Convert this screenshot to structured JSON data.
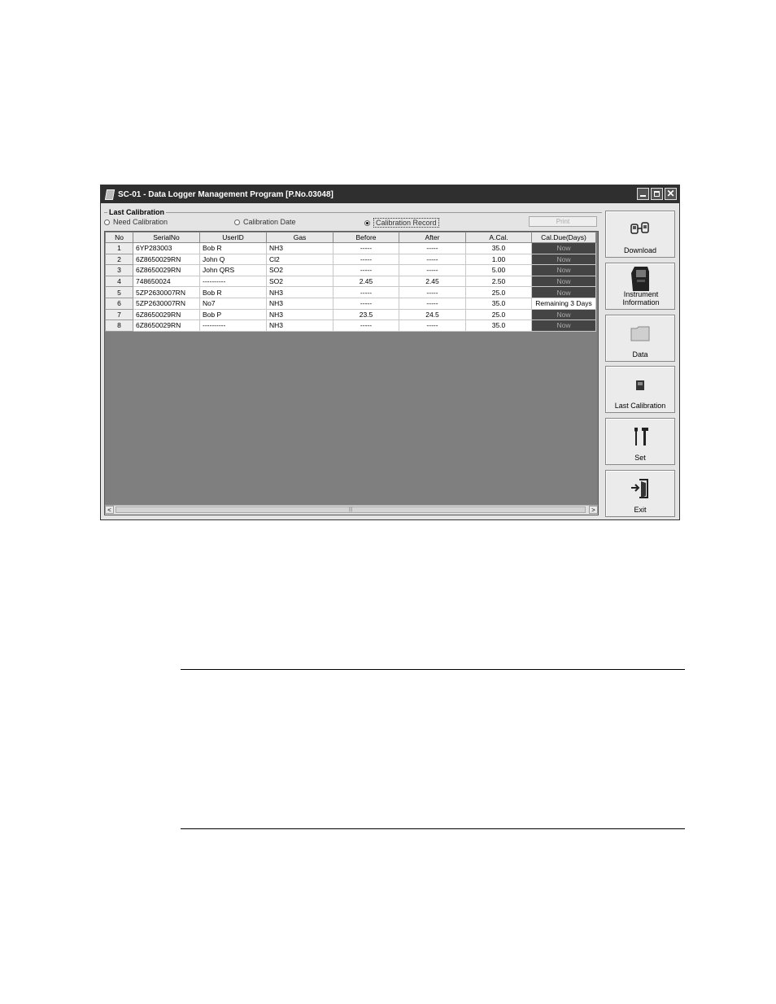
{
  "window": {
    "title": "SC-01 - Data Logger Management Program [P.No.03048]",
    "close_glyph": "✕"
  },
  "filter": {
    "group_label": "Last Calibration",
    "options": [
      "Need Calibration",
      "Calibration Date",
      "Calibration Record"
    ],
    "selected": "Calibration Record",
    "print_label": "Print"
  },
  "table": {
    "columns": [
      "No",
      "SerialNo",
      "UserID",
      "Gas",
      "Before",
      "After",
      "A.Cal.",
      "Cal.Due(Days)"
    ],
    "rows": [
      {
        "no": "1",
        "serial": "6YP283003",
        "user": "Bob R",
        "gas": "NH3",
        "before": "-----",
        "after": "-----",
        "acal": "35.0",
        "due": "Now"
      },
      {
        "no": "2",
        "serial": "6Z8650029RN",
        "user": "John Q",
        "gas": "Cl2",
        "before": "-----",
        "after": "-----",
        "acal": "1.00",
        "due": "Now"
      },
      {
        "no": "3",
        "serial": "6Z8650029RN",
        "user": "John QRS",
        "gas": "SO2",
        "before": "-----",
        "after": "-----",
        "acal": "5.00",
        "due": "Now"
      },
      {
        "no": "4",
        "serial": "748650024",
        "user": "----------",
        "gas": "SO2",
        "before": "2.45",
        "after": "2.45",
        "acal": "2.50",
        "due": "Now"
      },
      {
        "no": "5",
        "serial": "5ZP2630007RN",
        "user": "Bob R",
        "gas": "NH3",
        "before": "-----",
        "after": "-----",
        "acal": "25.0",
        "due": "Now"
      },
      {
        "no": "6",
        "serial": "5ZP2630007RN",
        "user": "No7",
        "gas": "NH3",
        "before": "-----",
        "after": "-----",
        "acal": "35.0",
        "due": "Remaining 3 Days"
      },
      {
        "no": "7",
        "serial": "6Z8650029RN",
        "user": "Bob P",
        "gas": "NH3",
        "before": "23.5",
        "after": "24.5",
        "acal": "25.0",
        "due": "Now"
      },
      {
        "no": "8",
        "serial": "6Z8650029RN",
        "user": "----------",
        "gas": "NH3",
        "before": "-----",
        "after": "-----",
        "acal": "35.0",
        "due": "Now"
      }
    ]
  },
  "scrollbar": {
    "left_arrow": "<",
    "right_arrow": ">",
    "thumb_grip": "|||"
  },
  "sidebar": {
    "buttons": [
      {
        "label": "Download",
        "icon": "download-icon"
      },
      {
        "label": "Instrument Information",
        "icon": "instrument-icon"
      },
      {
        "label": "Data",
        "icon": "folder-icon"
      },
      {
        "label": "Last Calibration",
        "icon": "calibration-icon"
      },
      {
        "label": "Set",
        "icon": "tools-icon"
      },
      {
        "label": "Exit",
        "icon": "exit-door-icon"
      }
    ]
  }
}
